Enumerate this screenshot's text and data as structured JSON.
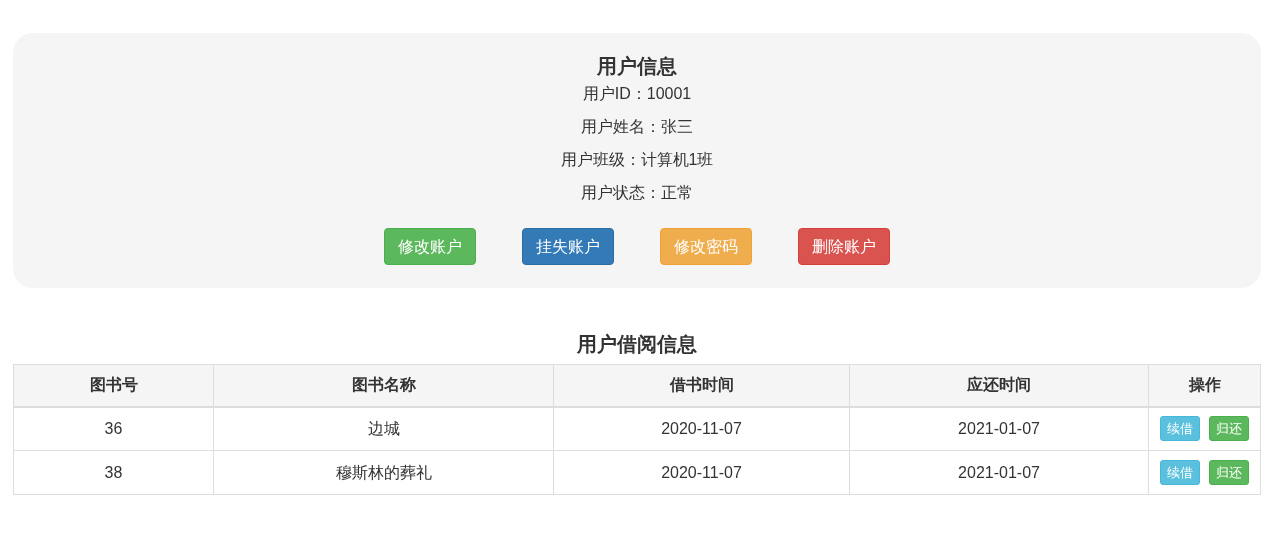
{
  "user_info": {
    "title": "用户信息",
    "fields": [
      "用户ID：10001",
      "用户姓名：张三",
      "用户班级：计算机1班",
      "用户状态：正常"
    ],
    "buttons": [
      {
        "label": "修改账户",
        "kind": "success"
      },
      {
        "label": "挂失账户",
        "kind": "primary"
      },
      {
        "label": "修改密码",
        "kind": "warning"
      },
      {
        "label": "删除账户",
        "kind": "danger"
      }
    ]
  },
  "borrow_info": {
    "title": "用户借阅信息",
    "table": {
      "columns": [
        "图书号",
        "图书名称",
        "借书时间",
        "应还时间",
        "操作"
      ],
      "rows": [
        {
          "cells": [
            "36",
            "边城",
            "2020-11-07",
            "2021-01-07"
          ],
          "actions": [
            {
              "label": "续借",
              "kind": "info"
            },
            {
              "label": "归还",
              "kind": "success"
            }
          ]
        },
        {
          "cells": [
            "38",
            "穆斯林的葬礼",
            "2020-11-07",
            "2021-01-07"
          ],
          "actions": [
            {
              "label": "续借",
              "kind": "info"
            },
            {
              "label": "归还",
              "kind": "success"
            }
          ]
        }
      ]
    }
  }
}
